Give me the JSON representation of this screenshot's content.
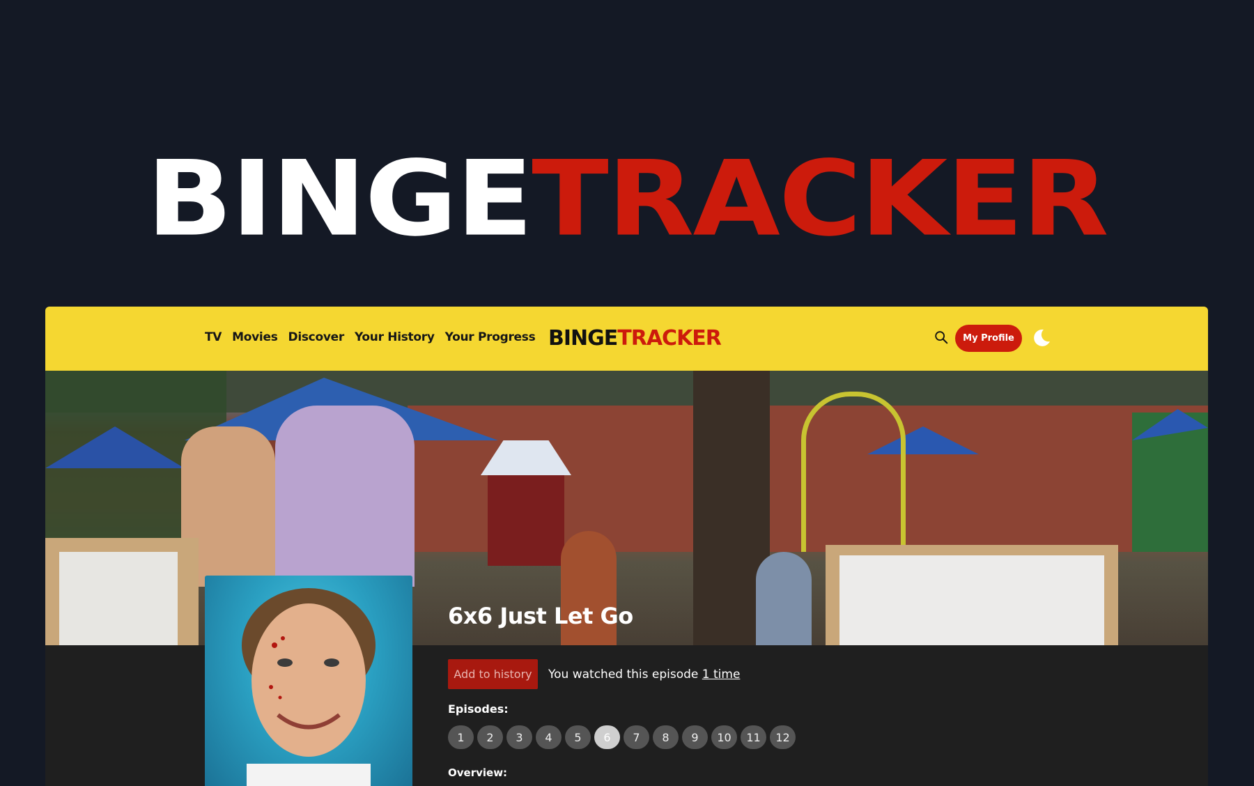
{
  "hero": {
    "logo_left": "BINGE",
    "logo_right": "TRACKER"
  },
  "navbar": {
    "links": [
      "TV",
      "Movies",
      "Discover",
      "Your History",
      "Your Progress"
    ],
    "logo_left": "BINGE",
    "logo_right": "TRACKER",
    "profile_label": "My Profile",
    "icons": [
      "search-icon",
      "moon-icon"
    ]
  },
  "episode": {
    "title": "6x6 Just Let Go",
    "add_label": "Add to history",
    "watched_prefix": "You watched this episode ",
    "watched_count": "1 time",
    "episodes_label": "Episodes:",
    "episodes": [
      "1",
      "2",
      "3",
      "4",
      "5",
      "6",
      "7",
      "8",
      "9",
      "10",
      "11",
      "12"
    ],
    "active_episode": "6",
    "overview_label": "Overview:"
  },
  "colors": {
    "page_bg": "#141925",
    "brand_red": "#cc1b0c",
    "nav_yellow": "#f5d731",
    "panel_bg": "#1f1f1f"
  }
}
